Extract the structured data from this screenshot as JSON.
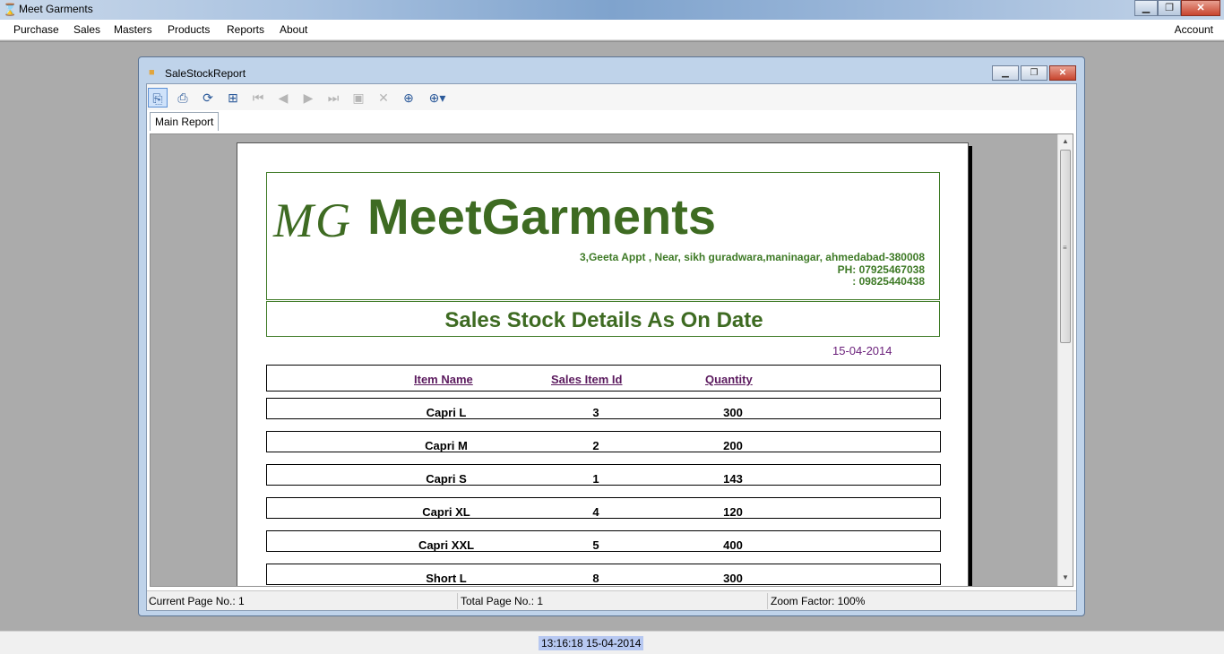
{
  "app": {
    "title": "Meet Garments",
    "icon": "hourglass-icon"
  },
  "menu": {
    "purchase": "Purchase",
    "sales": "Sales",
    "masters": "Masters",
    "products": "Products",
    "reports": "Reports",
    "about": "About",
    "account": "Account"
  },
  "window_controls": {
    "minimize": "▁",
    "maximize": "❐",
    "close": "✕"
  },
  "child_window": {
    "title": "SaleStockReport"
  },
  "toolbar": {
    "icons": [
      "export-icon",
      "print-icon",
      "refresh-icon",
      "group-tree-icon",
      "first-page-icon",
      "previous-page-icon",
      "next-page-icon",
      "last-page-icon",
      "goto-page-icon",
      "stop-icon",
      "find-icon",
      "zoom-icon"
    ]
  },
  "tabs": {
    "main": "Main Report"
  },
  "report": {
    "logo": "MG",
    "brand": "MeetGarments",
    "address": "3,Geeta Appt , Near, sikh guradwara,maninagar, ahmedabad-380008",
    "phone1": "PH: 07925467038",
    "phone2": ": 09825440438",
    "title": "Sales Stock Details As On Date",
    "date": "15-04-2014",
    "columns": {
      "item_name": "Item Name",
      "sales_item_id": "Sales Item Id",
      "quantity": "Quantity"
    },
    "rows": [
      {
        "name": "Capri L",
        "id": "3",
        "qty": "300"
      },
      {
        "name": "Capri M",
        "id": "2",
        "qty": "200"
      },
      {
        "name": "Capri S",
        "id": "1",
        "qty": "143"
      },
      {
        "name": "Capri XL",
        "id": "4",
        "qty": "120"
      },
      {
        "name": "Capri XXL",
        "id": "5",
        "qty": "400"
      },
      {
        "name": "Short L",
        "id": "8",
        "qty": "300"
      }
    ]
  },
  "viewer_status": {
    "current_page": "Current Page No.: 1",
    "total_page": "Total Page No.: 1",
    "zoom": "Zoom Factor: 100%"
  },
  "status": {
    "clock": "13:16:18 15-04-2014"
  },
  "colors": {
    "brand_green": "#3e6b22",
    "date_purple": "#6a1f7a",
    "header_purple": "#5b1a5e"
  }
}
